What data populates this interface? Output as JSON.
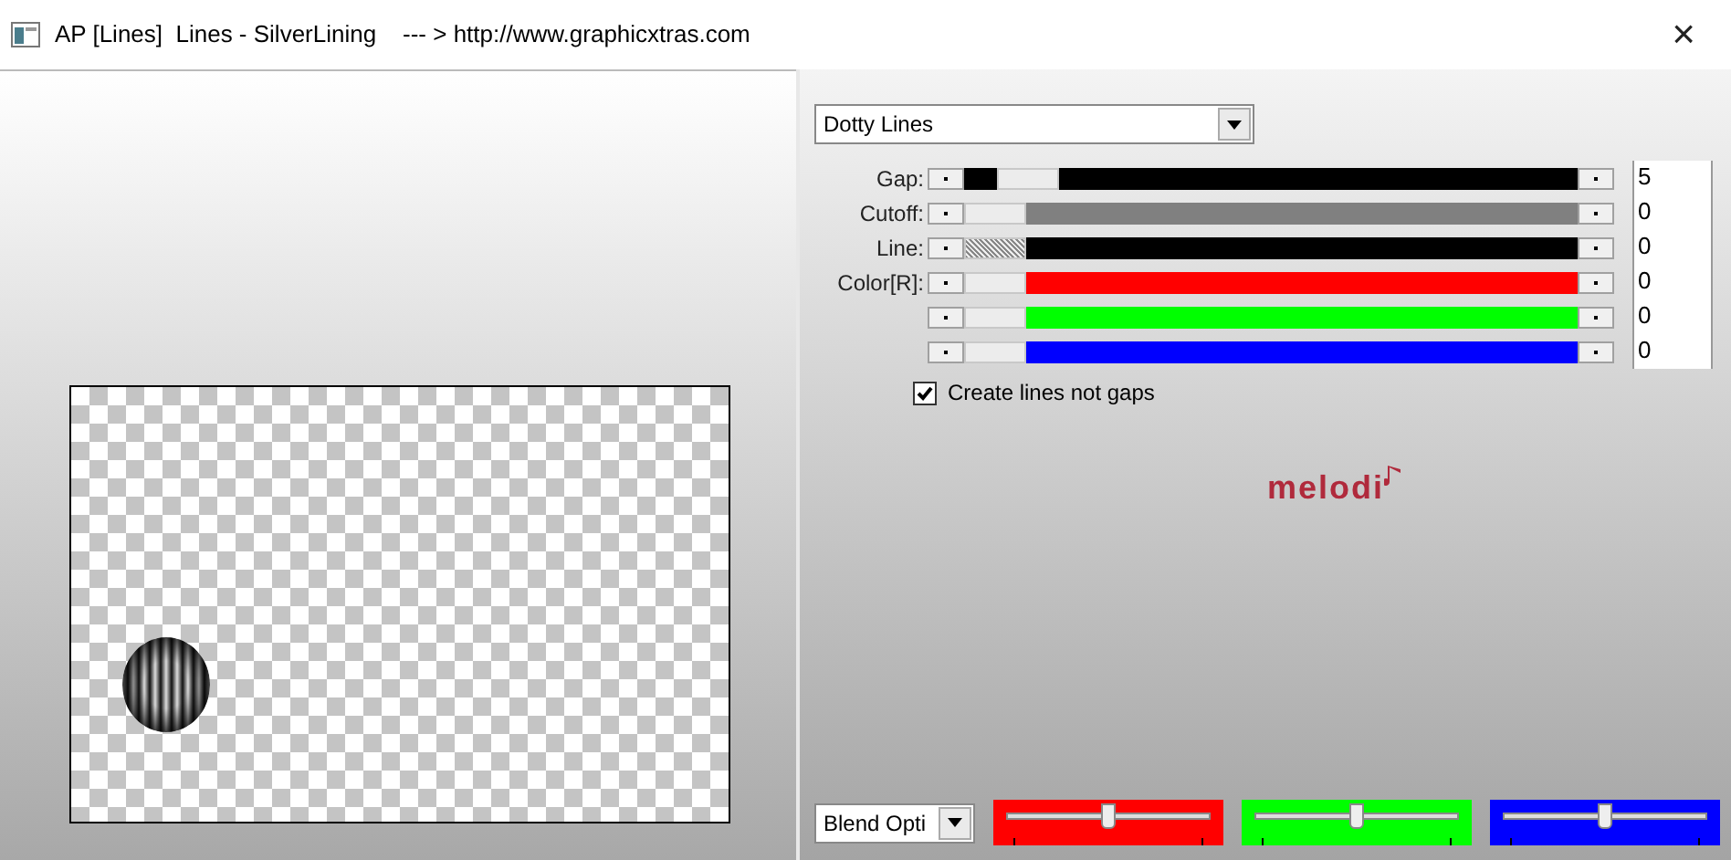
{
  "window": {
    "title": "AP [Lines]  Lines - SilverLining    --- > http://www.graphicxtras.com",
    "close": "×"
  },
  "mode_dropdown": {
    "value": "Dotty Lines"
  },
  "sliders": [
    {
      "label": "Gap:",
      "level": 0.06,
      "color": "#000000",
      "kind": "plain",
      "value": "5"
    },
    {
      "label": "Cutoff:",
      "level": 0,
      "color": "#808080",
      "kind": "plain",
      "value": "0"
    },
    {
      "label": "Line:",
      "level": 0,
      "color": "#000000",
      "kind": "hatched",
      "value": "0"
    },
    {
      "label": "Color[R]:",
      "level": 0,
      "color": "#ff0000",
      "kind": "plain",
      "value": "0"
    },
    {
      "level": 0,
      "color": "#00ff00",
      "kind": "plain",
      "value": "0"
    },
    {
      "level": 0,
      "color": "#0000ff",
      "kind": "plain",
      "value": "0"
    }
  ],
  "checkbox": {
    "label": "Create lines not gaps",
    "checked": true
  },
  "logo": {
    "text": "melodi"
  },
  "blend_dropdown": {
    "value": "Blend Opti"
  },
  "blend_sliders": [
    {
      "color": "#ff0000",
      "level": 0.5
    },
    {
      "color": "#00ff00",
      "level": 0.5
    },
    {
      "color": "#0000ff",
      "level": 0.5
    }
  ]
}
